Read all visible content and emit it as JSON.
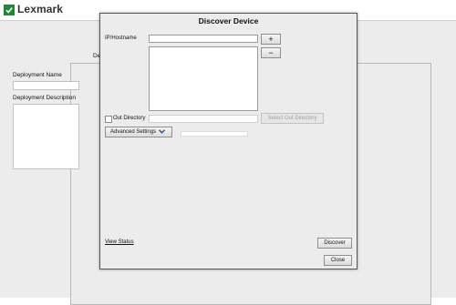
{
  "app": {
    "logo_text": "Lexmark",
    "brand_color": "#1e8a34"
  },
  "background": {
    "deployment_name_label": "Deployment Name",
    "deployment_description_label": "Deployment Description",
    "partial_label": "De"
  },
  "dialog": {
    "title": "Discover Device",
    "ip_hostname_label": "IP/Hostname",
    "ip_hostname_value": "",
    "add_button": "+",
    "remove_button": "−",
    "out_directory_label": "Out Directory",
    "out_directory_checked": false,
    "out_directory_value": "",
    "select_out_directory_button": "Select Out Directory",
    "advanced_settings_button": "Advanced Settings",
    "advanced_settings_icon": "chevron-down-icon",
    "view_status_link": "View Status",
    "discover_button": "Discover",
    "close_button": "Close"
  }
}
